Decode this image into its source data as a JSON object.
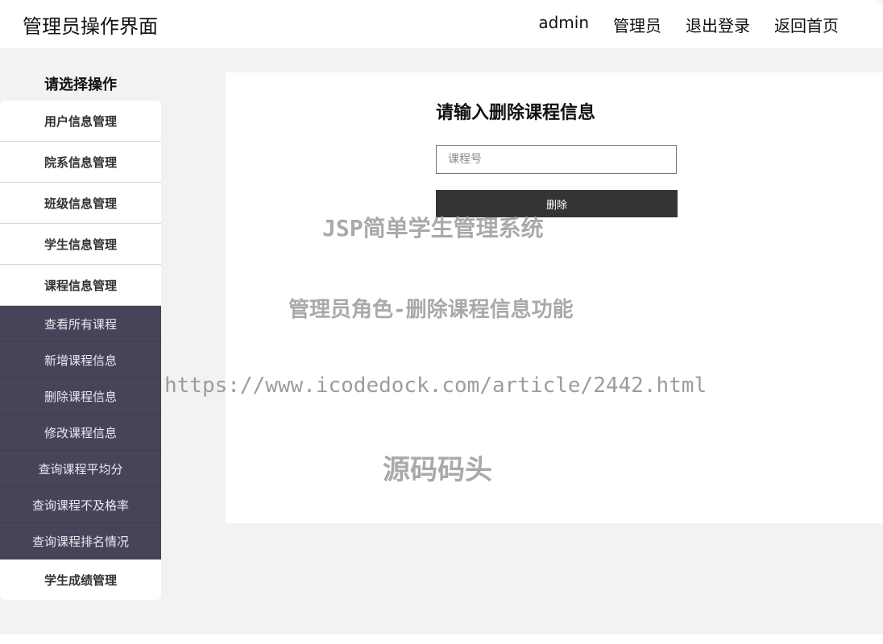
{
  "header": {
    "title": "管理员操作界面",
    "nav": {
      "username": "admin",
      "role": "管理员",
      "logout": "退出登录",
      "home": "返回首页"
    }
  },
  "sidebar": {
    "heading": "请选择操作",
    "items": [
      {
        "label": "用户信息管理"
      },
      {
        "label": "院系信息管理"
      },
      {
        "label": "班级信息管理"
      },
      {
        "label": "学生信息管理"
      },
      {
        "label": "课程信息管理"
      }
    ],
    "subitems": [
      {
        "label": "查看所有课程"
      },
      {
        "label": "新增课程信息"
      },
      {
        "label": "删除课程信息"
      },
      {
        "label": "修改课程信息"
      },
      {
        "label": "查询课程平均分"
      },
      {
        "label": "查询课程不及格率"
      },
      {
        "label": "查询课程排名情况"
      }
    ],
    "last_item": {
      "label": "学生成绩管理"
    }
  },
  "form": {
    "title": "请输入删除课程信息",
    "course_id_placeholder": "课程号",
    "course_id_value": "",
    "submit_label": "删除"
  },
  "watermarks": {
    "line1": "JSP简单学生管理系统",
    "line2": "管理员角色-删除课程信息功能",
    "line3": "https://www.icodedock.com/article/2442.html",
    "line4": "源码码头"
  },
  "colors": {
    "submenu_bg": "#47445a",
    "button_bg": "#343434",
    "page_bg": "#f2f2f2"
  }
}
